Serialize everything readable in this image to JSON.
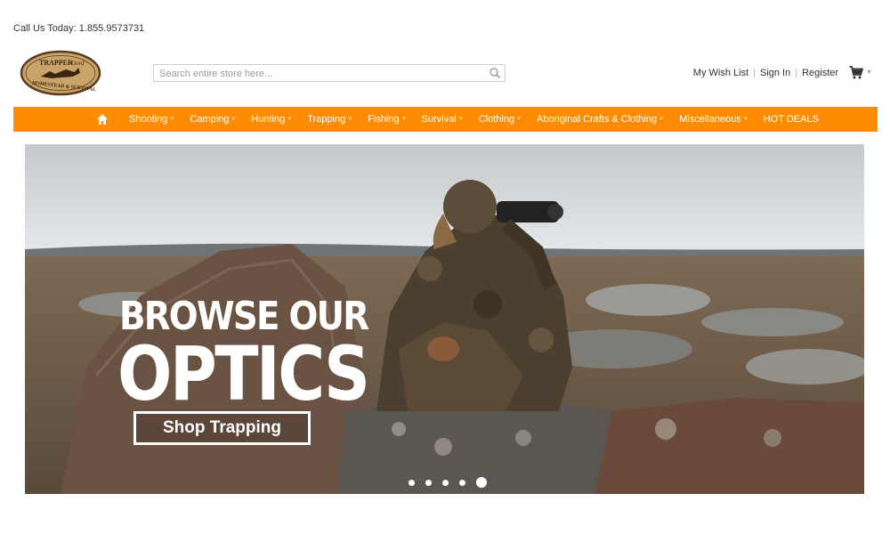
{
  "topbar": {
    "phone_text": "Call Us Today: 1.855.9573731"
  },
  "logo": {
    "line1": "TRAPPER",
    "line1b": "Gord",
    "line2": "HOMESTEAD & SURVIVAL",
    "icon": "fox-icon"
  },
  "search": {
    "placeholder": "Search entire store here...",
    "value": "",
    "icon": "search-icon"
  },
  "account": {
    "wishlist": "My Wish List",
    "signin": "Sign In",
    "register": "Register",
    "cart_icon": "cart-icon"
  },
  "nav": {
    "home_icon": "home-icon",
    "items": [
      {
        "label": "Shooting"
      },
      {
        "label": "Camping"
      },
      {
        "label": "Hunting"
      },
      {
        "label": "Trapping"
      },
      {
        "label": "Fishing"
      },
      {
        "label": "Survival"
      },
      {
        "label": "Clothing"
      },
      {
        "label": "Aboriginal Crafts & Clothing"
      },
      {
        "label": "Miscellaneous"
      },
      {
        "label": "HOT DEALS"
      }
    ]
  },
  "hero": {
    "headline_line1": "BROWSE OUR",
    "headline_line2": "OPTICS",
    "cta_label": "Shop Trapping",
    "slide_count": 5,
    "active_slide": 5
  },
  "colors": {
    "nav_bg": "#ff8c00",
    "logo_bg": "#c9a46a"
  }
}
